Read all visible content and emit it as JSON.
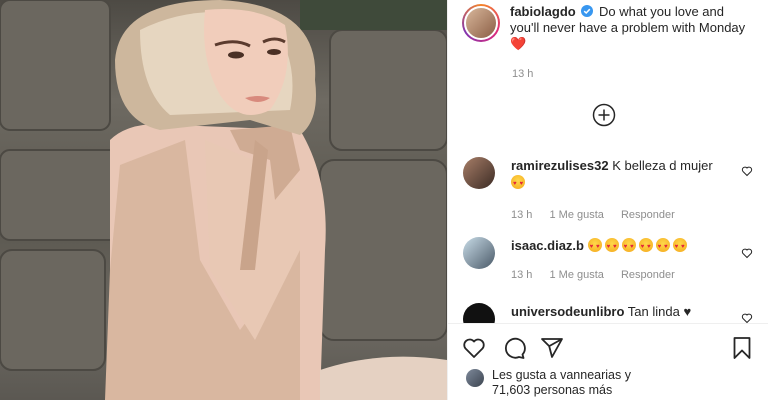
{
  "post": {
    "author": "fabiolagdo",
    "caption": "Do what you love and you'll never have a problem with Monday",
    "caption_emoji": "❤️",
    "caption_time": "13 h",
    "load_more_icon": "plus-circle-icon"
  },
  "comments": [
    {
      "user": "ramirezulises32",
      "text": "K belleza d mujer",
      "emoji_count": 1,
      "time": "13 h",
      "likes": "1 Me gusta",
      "reply": "Responder"
    },
    {
      "user": "isaac.diaz.b",
      "text": "",
      "emoji_count": 6,
      "time": "13 h",
      "likes": "1 Me gusta",
      "reply": "Responder"
    },
    {
      "user": "universodeunlibro",
      "text": "Tan linda ♥"
    }
  ],
  "likes": {
    "line1": "Les gusta a vannearias y",
    "line2": "71,603 personas más"
  },
  "icons": {
    "like": "heart-icon",
    "comment": "comment-icon",
    "share": "share-icon",
    "save": "bookmark-icon"
  }
}
